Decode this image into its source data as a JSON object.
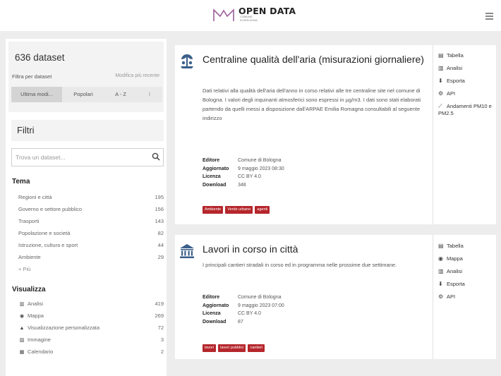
{
  "header": {
    "logo_title": "OPEN DATA",
    "logo_sub": [
      "COMUNE",
      "DI BOLOGNA"
    ]
  },
  "sidebar": {
    "dataset_count": "636 dataset",
    "sort_label": "Filtra per dataset",
    "sort_hint": "Modifica più recente",
    "sort_tabs": [
      "Ultima modi...",
      "Popolari",
      "A - Z",
      "⁝"
    ],
    "filters_title": "Filtri",
    "search_placeholder": "Trova un dataset...",
    "tema_title": "Tema",
    "tema_items": [
      {
        "label": "Regioni e città",
        "count": "195"
      },
      {
        "label": "Governo e settore pubblico",
        "count": "156"
      },
      {
        "label": "Trasporti",
        "count": "143"
      },
      {
        "label": "Popolazione e società",
        "count": "82"
      },
      {
        "label": "Istruzione, cultura e sport",
        "count": "44"
      },
      {
        "label": "Ambiente",
        "count": "29"
      }
    ],
    "more": "+ Più",
    "visualizza_title": "Visualizza",
    "visualizza_items": [
      {
        "label": "Analisi",
        "count": "419",
        "icon": "chart-icon"
      },
      {
        "label": "Mappa",
        "count": "269",
        "icon": "map-marker-icon"
      },
      {
        "label": "Visualizzazione personalizzata",
        "count": "72",
        "icon": "custom-view-icon"
      },
      {
        "label": "Immagine",
        "count": "3",
        "icon": "image-icon"
      },
      {
        "label": "Calendario",
        "count": "2",
        "icon": "calendar-icon"
      }
    ]
  },
  "cards": [
    {
      "title": "Centraline qualità dell'aria (misurazioni giornaliere)",
      "description": "Dati relativi alla qualità dell'aria dell'anno in corso relativi alle tre centraline site nel comune di Bologna. I valori degli inquinanti atmosferici sono espressi in µg/m3. I dati sono stati elaborati partendo da quelli messi a disposizione dall'ARPAE Emilia Romagna consultabili al seguente indirizzo",
      "meta": [
        {
          "key": "Editore",
          "value": "Comune di Bologna"
        },
        {
          "key": "Aggiornato",
          "value": "9 maggio 2023 08:30"
        },
        {
          "key": "Licenza",
          "value": "CC BY 4.0"
        },
        {
          "key": "Download",
          "value": "348"
        }
      ],
      "tags": [
        "Ambiente",
        "Verde urbano",
        "agenti"
      ],
      "actions": [
        "Tabella",
        "Analisi",
        "Esporta",
        "API",
        "Andamenti PM10 e PM2.5"
      ]
    },
    {
      "title": "Lavori in corso in città",
      "description": "I principali cantieri stradali in corso ed in programma nelle prossime due settimane.",
      "meta": [
        {
          "key": "Editore",
          "value": "Comune di Bologna"
        },
        {
          "key": "Aggiornato",
          "value": "9 maggio 2023 07:00"
        },
        {
          "key": "Licenza",
          "value": "CC BY 4.0"
        },
        {
          "key": "Download",
          "value": "87"
        }
      ],
      "tags": [
        "lavori",
        "lavori pubblici",
        "cantieri"
      ],
      "actions": [
        "Tabella",
        "Mappa",
        "Analisi",
        "Esporta",
        "API"
      ]
    }
  ],
  "colors": {
    "accent": "#b5262b",
    "background": "#ededed",
    "icon_blue": "#3a5f8a"
  }
}
